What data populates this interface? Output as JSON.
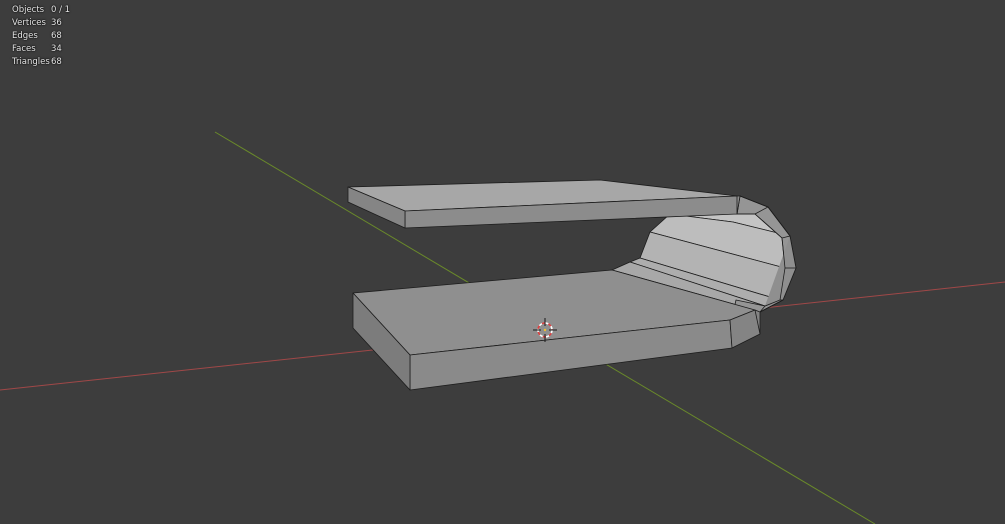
{
  "viewport": {
    "background": "#3d3d3d",
    "colors": {
      "x_axis": "#a04848",
      "y_axis": "#6a8a2a",
      "mesh_top": "#a9a9a9",
      "mesh_side": "#8a8a8a",
      "mesh_inner": "#b8b8b8",
      "edge": "#1c1c1c",
      "cursor_red": "#e04040",
      "cursor_white": "#ffffff"
    }
  },
  "stats": [
    {
      "label": "Objects",
      "value": "0 / 1"
    },
    {
      "label": "Vertices",
      "value": "36"
    },
    {
      "label": "Edges",
      "value": "68"
    },
    {
      "label": "Faces",
      "value": "34"
    },
    {
      "label": "Triangles",
      "value": "68"
    }
  ],
  "icons": {
    "cursor": "3d-cursor-icon"
  }
}
